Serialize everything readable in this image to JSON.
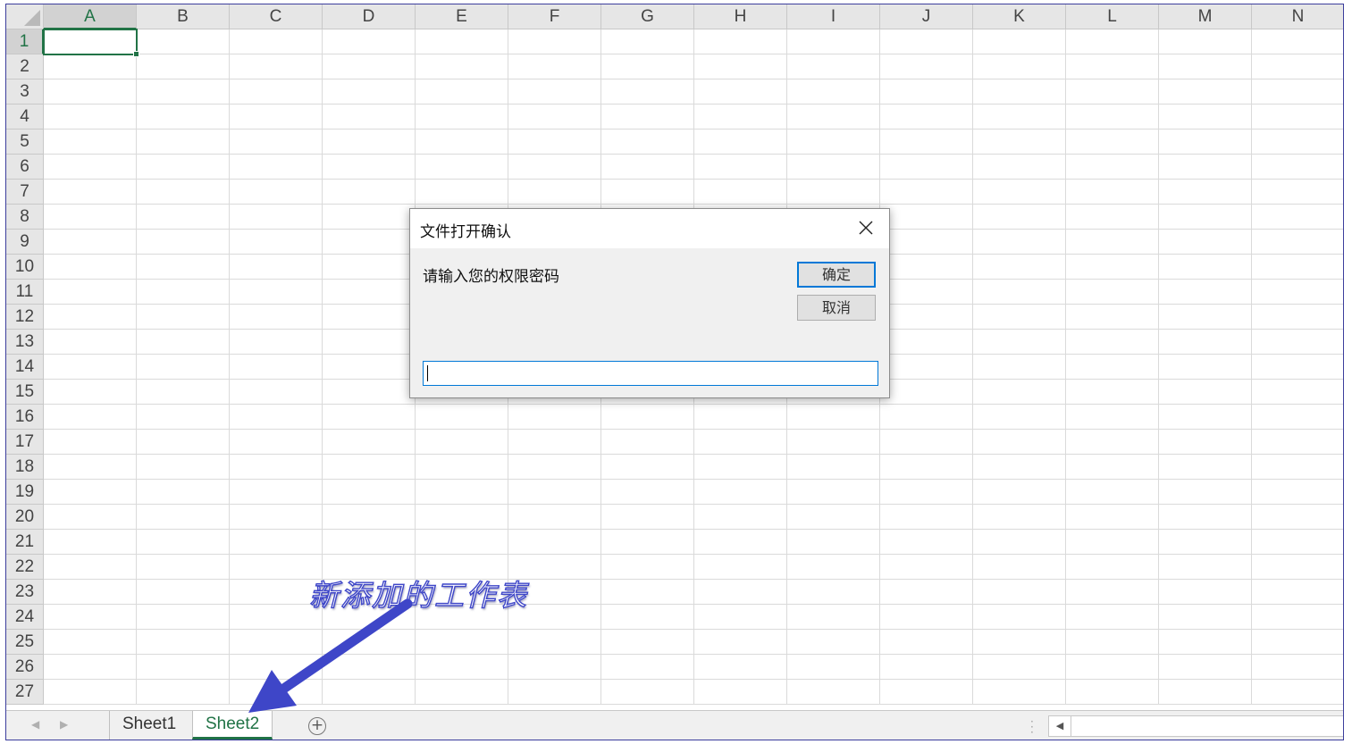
{
  "spreadsheet": {
    "columns": [
      "A",
      "B",
      "C",
      "D",
      "E",
      "F",
      "G",
      "H",
      "I",
      "J",
      "K",
      "L",
      "M",
      "N"
    ],
    "rows": [
      "1",
      "2",
      "3",
      "4",
      "5",
      "6",
      "7",
      "8",
      "9",
      "10",
      "11",
      "12",
      "13",
      "14",
      "15",
      "16",
      "17",
      "18",
      "19",
      "20",
      "21",
      "22",
      "23",
      "24",
      "25",
      "26",
      "27"
    ],
    "active_column": "A",
    "active_row": "1",
    "accent_color": "#217346"
  },
  "sheet_tabs": [
    {
      "label": "Sheet1",
      "active": false
    },
    {
      "label": "Sheet2",
      "active": true
    }
  ],
  "sheet_bar": {
    "add_sheet_icon": "plus-circle-icon",
    "nav_prev_icon": "chevron-left-icon",
    "nav_next_icon": "chevron-right-icon"
  },
  "dialog": {
    "title": "文件打开确认",
    "prompt": "请输入您的权限密码",
    "ok_label": "确定",
    "cancel_label": "取消",
    "input_value": "",
    "close_icon": "close-icon"
  },
  "annotation": {
    "text": "新添加的工作表",
    "color": "#3e46c8"
  }
}
